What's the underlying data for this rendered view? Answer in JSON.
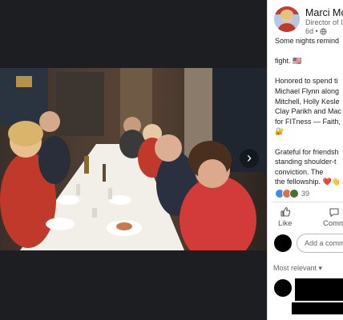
{
  "post": {
    "author": "Marci Mc",
    "role": "Director of I",
    "time": "6d •",
    "text_lines": [
      "Some nights remind",
      "fight. 🇺🇸",
      "",
      "Honored to spend ti",
      "Michael Flynn along",
      "Mitchell, Holly Kesle",
      "Clay Parikh and Mac",
      "for FITness — Faith,",
      "🔐",
      "",
      "Grateful for friendsh",
      "standing shoulder-t",
      "conviction. The",
      "the fellowship. ❤️👋"
    ],
    "reaction_count": "39",
    "reaction_colors": [
      "#378fe9",
      "#df704d",
      "#44712e"
    ]
  },
  "actions": {
    "like": "Like",
    "comment": "Comm"
  },
  "comment_box": {
    "placeholder": "Add a comm"
  },
  "comments": {
    "sort_label": "Most relevant ▾"
  },
  "viewer": {
    "next_icon": "›"
  }
}
